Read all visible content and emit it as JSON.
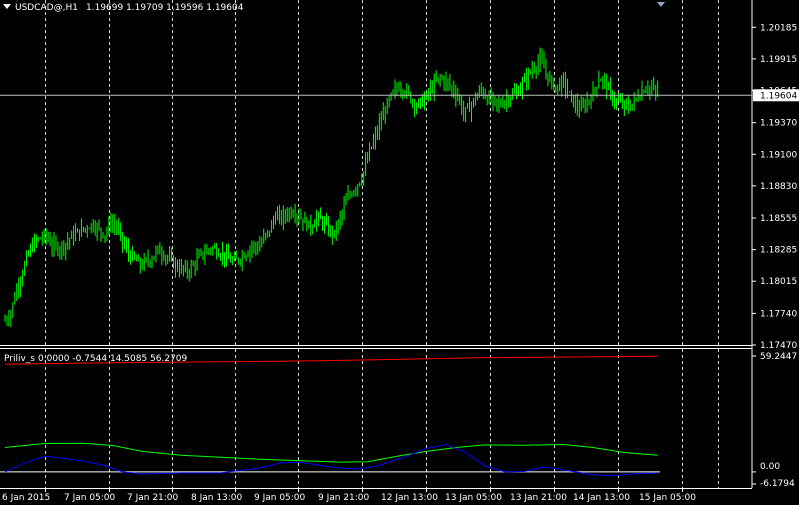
{
  "chart_data": [
    {
      "type": "candlestick",
      "title": "USDCAD@,H1",
      "ohlc_header": [
        "1.19699",
        "1.19709",
        "1.19596",
        "1.19604"
      ],
      "current_price": 1.19604,
      "current_price_label": "1.19604",
      "ylim": [
        1.1747,
        1.2035
      ],
      "y_ticks": [
        {
          "value": 1.20185,
          "label": "1.20185"
        },
        {
          "value": 1.19915,
          "label": "1.19915"
        },
        {
          "value": 1.19645,
          "label": "1.19645"
        },
        {
          "value": 1.1937,
          "label": "1.19370"
        },
        {
          "value": 1.191,
          "label": "1.19100"
        },
        {
          "value": 1.1883,
          "label": "1.18830"
        },
        {
          "value": 1.18555,
          "label": "1.18555"
        },
        {
          "value": 1.18285,
          "label": "1.18285"
        },
        {
          "value": 1.18015,
          "label": "1.18015"
        },
        {
          "value": 1.1774,
          "label": "1.17740"
        },
        {
          "value": 1.1747,
          "label": "1.17470"
        }
      ],
      "close_path": [
        [
          0,
          1.1768
        ],
        [
          3,
          1.1775
        ],
        [
          6,
          1.1795
        ],
        [
          9,
          1.181
        ],
        [
          12,
          1.1825
        ],
        [
          15,
          1.1835
        ],
        [
          18,
          1.1838
        ],
        [
          21,
          1.184
        ],
        [
          24,
          1.1832
        ],
        [
          27,
          1.183
        ],
        [
          30,
          1.1832
        ],
        [
          33,
          1.1838
        ],
        [
          36,
          1.1842
        ],
        [
          39,
          1.1845
        ],
        [
          42,
          1.1848
        ],
        [
          45,
          1.185
        ],
        [
          48,
          1.1845
        ],
        [
          51,
          1.1842
        ],
        [
          54,
          1.1852
        ],
        [
          57,
          1.1848
        ],
        [
          60,
          1.1835
        ],
        [
          63,
          1.1825
        ],
        [
          66,
          1.182
        ],
        [
          69,
          1.1815
        ],
        [
          72,
          1.1818
        ],
        [
          75,
          1.1822
        ],
        [
          78,
          1.1828
        ],
        [
          81,
          1.1825
        ],
        [
          84,
          1.182
        ],
        [
          87,
          1.1815
        ],
        [
          90,
          1.1812
        ],
        [
          93,
          1.181
        ],
        [
          96,
          1.1815
        ],
        [
          99,
          1.1822
        ],
        [
          102,
          1.1826
        ],
        [
          105,
          1.183
        ],
        [
          108,
          1.1828
        ],
        [
          111,
          1.1825
        ],
        [
          114,
          1.182
        ],
        [
          117,
          1.1818
        ],
        [
          120,
          1.1822
        ],
        [
          123,
          1.1826
        ],
        [
          126,
          1.1832
        ],
        [
          129,
          1.183
        ],
        [
          132,
          1.1838
        ],
        [
          135,
          1.1845
        ],
        [
          138,
          1.1858
        ],
        [
          141,
          1.1855
        ],
        [
          144,
          1.186
        ],
        [
          147,
          1.1862
        ],
        [
          150,
          1.1858
        ],
        [
          153,
          1.1852
        ],
        [
          156,
          1.1848
        ],
        [
          159,
          1.1856
        ],
        [
          162,
          1.1852
        ],
        [
          165,
          1.1845
        ],
        [
          168,
          1.1842
        ],
        [
          171,
          1.1855
        ],
        [
          174,
          1.187
        ],
        [
          177,
          1.1878
        ],
        [
          180,
          1.1885
        ],
        [
          183,
          1.1895
        ],
        [
          186,
          1.1912
        ],
        [
          189,
          1.1925
        ],
        [
          192,
          1.194
        ],
        [
          195,
          1.1952
        ],
        [
          198,
          1.1962
        ],
        [
          201,
          1.1968
        ],
        [
          204,
          1.1965
        ],
        [
          207,
          1.1958
        ],
        [
          210,
          1.1952
        ],
        [
          213,
          1.1955
        ],
        [
          216,
          1.1962
        ],
        [
          219,
          1.197
        ],
        [
          222,
          1.1975
        ],
        [
          225,
          1.1972
        ],
        [
          228,
          1.1966
        ],
        [
          231,
          1.196
        ],
        [
          234,
          1.1945
        ],
        [
          237,
          1.195
        ],
        [
          240,
          1.1958
        ],
        [
          243,
          1.1965
        ],
        [
          246,
          1.1958
        ],
        [
          249,
          1.1955
        ],
        [
          252,
          1.1952
        ],
        [
          255,
          1.1956
        ],
        [
          258,
          1.196
        ],
        [
          261,
          1.1962
        ],
        [
          264,
          1.197
        ],
        [
          267,
          1.1978
        ],
        [
          270,
          1.1985
        ],
        [
          273,
          1.199
        ],
        [
          276,
          1.198
        ],
        [
          279,
          1.197
        ],
        [
          282,
          1.1968
        ],
        [
          285,
          1.1972
        ],
        [
          288,
          1.196
        ],
        [
          291,
          1.1952
        ],
        [
          294,
          1.1948
        ],
        [
          297,
          1.1955
        ],
        [
          300,
          1.1962
        ],
        [
          303,
          1.1975
        ],
        [
          306,
          1.1972
        ],
        [
          309,
          1.196
        ],
        [
          312,
          1.1955
        ],
        [
          315,
          1.1952
        ],
        [
          318,
          1.195
        ],
        [
          321,
          1.1955
        ],
        [
          324,
          1.1962
        ],
        [
          327,
          1.1968
        ],
        [
          330,
          1.1966
        ],
        [
          333,
          1.1962
        ]
      ],
      "x_labels": [
        "6 Jan 2015",
        "7 Jan 05:00",
        "7 Jan 21:00",
        "8 Jan 13:00",
        "9 Jan 05:00",
        "9 Jan 21:00",
        "12 Jan 13:00",
        "13 Jan 05:00",
        "13 Jan 21:00",
        "14 Jan 13:00",
        "15 Jan 05:00"
      ],
      "grid": "dashed vertical",
      "colors": {
        "bull": "#00ff00",
        "bear": "#00ff00",
        "background": "#000000",
        "grid": "#ffffff",
        "price_line": "#c0c0c0"
      }
    },
    {
      "type": "line",
      "title": "Priliv_s",
      "header_values": [
        "0.0000",
        "-0.7544",
        "14.5085",
        "56.2709"
      ],
      "ylim": [
        -6.1794,
        59.2447
      ],
      "y_ticks": [
        {
          "value": 59.2447,
          "label": "59.2447"
        },
        {
          "value": 0.0,
          "label": "0.00"
        },
        {
          "value": -6.1794,
          "label": "-6.1794"
        }
      ],
      "series": [
        {
          "color": "#ff0000",
          "points": [
            [
              0,
              55.0
            ],
            [
              40,
              55.6
            ],
            [
              80,
              56.0
            ],
            [
              120,
              56.4
            ],
            [
              160,
              56.8
            ],
            [
              200,
              57.5
            ],
            [
              240,
              58.3
            ],
            [
              280,
              58.7
            ],
            [
              320,
              59.0
            ],
            [
              333,
              59.2
            ]
          ]
        },
        {
          "color": "#00ff00",
          "points": [
            [
              0,
              12.5
            ],
            [
              10,
              13.5
            ],
            [
              20,
              14.5
            ],
            [
              40,
              14.6
            ],
            [
              55,
              13.5
            ],
            [
              70,
              10.5
            ],
            [
              90,
              8.5
            ],
            [
              110,
              7.5
            ],
            [
              130,
              6.5
            ],
            [
              150,
              5.8
            ],
            [
              170,
              5.0
            ],
            [
              185,
              5.2
            ],
            [
              200,
              8.0
            ],
            [
              215,
              10.5
            ],
            [
              230,
              12.5
            ],
            [
              245,
              13.8
            ],
            [
              265,
              13.6
            ],
            [
              285,
              14.0
            ],
            [
              300,
              12.5
            ],
            [
              315,
              10.0
            ],
            [
              333,
              8.5
            ]
          ]
        },
        {
          "color": "#0000ff",
          "points": [
            [
              0,
              0.0
            ],
            [
              10,
              4.5
            ],
            [
              20,
              8.0
            ],
            [
              30,
              7.0
            ],
            [
              40,
              5.5
            ],
            [
              50,
              3.5
            ],
            [
              60,
              0.0
            ],
            [
              70,
              -1.0
            ],
            [
              90,
              -0.5
            ],
            [
              110,
              -0.5
            ],
            [
              130,
              2.0
            ],
            [
              140,
              4.5
            ],
            [
              150,
              5.0
            ],
            [
              160,
              3.5
            ],
            [
              170,
              2.0
            ],
            [
              180,
              1.5
            ],
            [
              190,
              3.0
            ],
            [
              205,
              8.0
            ],
            [
              215,
              12.0
            ],
            [
              225,
              14.0
            ],
            [
              235,
              10.0
            ],
            [
              245,
              3.0
            ],
            [
              255,
              0.0
            ],
            [
              265,
              0.2
            ],
            [
              275,
              2.5
            ],
            [
              285,
              1.0
            ],
            [
              300,
              -1.5
            ],
            [
              310,
              -2.0
            ],
            [
              320,
              -1.0
            ],
            [
              333,
              -0.5
            ]
          ]
        }
      ],
      "reference_line": {
        "value": 0.0,
        "color": "#ffffff"
      }
    }
  ]
}
